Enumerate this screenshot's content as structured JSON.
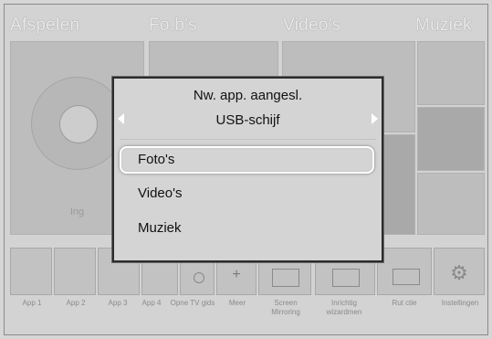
{
  "categories": [
    "Afspelen",
    "Fo.b's",
    "Video's",
    "Muziek"
  ],
  "background": {
    "playing_label": "Ing",
    "apps": [
      {
        "label": "App 1"
      },
      {
        "label": "App 2"
      },
      {
        "label": "App 3"
      },
      {
        "label": "App 4"
      },
      {
        "label": "Opne TV gids"
      },
      {
        "label": "Meer",
        "glyph": "+"
      },
      {
        "label": "Screen Mirroring"
      },
      {
        "label": "Inrichtig wizardmen"
      },
      {
        "label": "Rut ctie"
      },
      {
        "label": "Instellingen"
      }
    ]
  },
  "dialog": {
    "title": "Nw. app. aangesl.",
    "source": "USB-schijf",
    "options": [
      "Foto's",
      "Video's",
      "Muziek"
    ],
    "selected_index": 0
  },
  "colors": {
    "dialog_bg": "#d4d4d4",
    "dialog_border": "#2b2b2b",
    "highlight": "#ffffff"
  }
}
